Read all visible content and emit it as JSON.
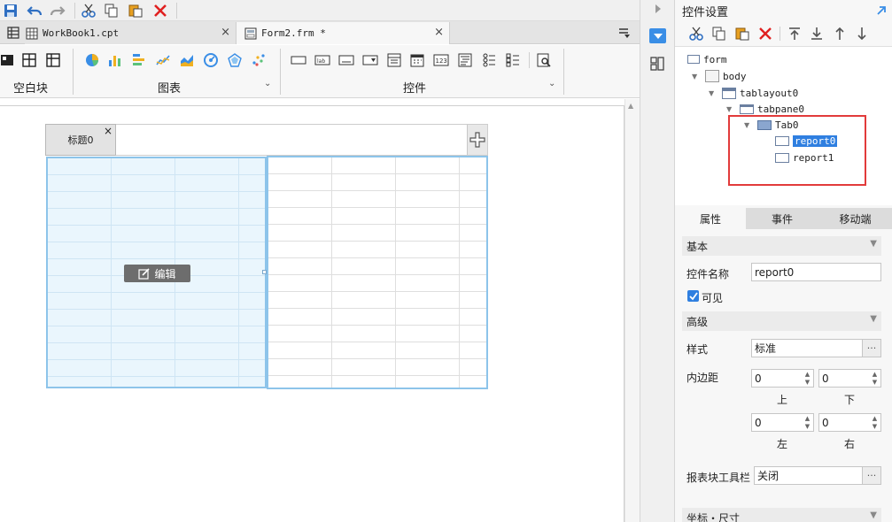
{
  "tabs": [
    {
      "label": "WorkBook1.cpt",
      "close": "×"
    },
    {
      "label": "Form2.frm *",
      "close": "×"
    }
  ],
  "ribbon": {
    "groups": [
      "空白块",
      "图表",
      "控件"
    ],
    "chevron": "⌄"
  },
  "canvas": {
    "tab_title": "标题0",
    "tab_close": "×",
    "edit_button": "编辑"
  },
  "panel": {
    "title": "控件设置",
    "tree": [
      {
        "label": "form"
      },
      {
        "label": "body"
      },
      {
        "label": "tablayout0"
      },
      {
        "label": "tabpane0"
      },
      {
        "label": "Tab0"
      },
      {
        "label": "report0",
        "selected": true
      },
      {
        "label": "report1"
      }
    ],
    "prop_tabs": [
      "属性",
      "事件",
      "移动端"
    ],
    "sections": {
      "basic": "基本",
      "advanced": "高级",
      "coords": "坐标・尺寸"
    },
    "props": {
      "name_label": "控件名称",
      "name_value": "report0",
      "visible_label": "可见",
      "style_label": "样式",
      "style_value": "标准",
      "padding_label": "内边距",
      "padding": {
        "top": "0",
        "bottom": "0",
        "left": "0",
        "right": "0"
      },
      "padding_labels": {
        "top": "上",
        "bottom": "下",
        "left": "左",
        "right": "右"
      },
      "toolbar_label": "报表块工具栏",
      "toolbar_value": "关闭",
      "more": "···"
    }
  },
  "colors": {
    "accent": "#3a8ee6",
    "highlight": "#e23b3b",
    "delete": "#e02020",
    "selected_bg": "#2f7fe0"
  }
}
